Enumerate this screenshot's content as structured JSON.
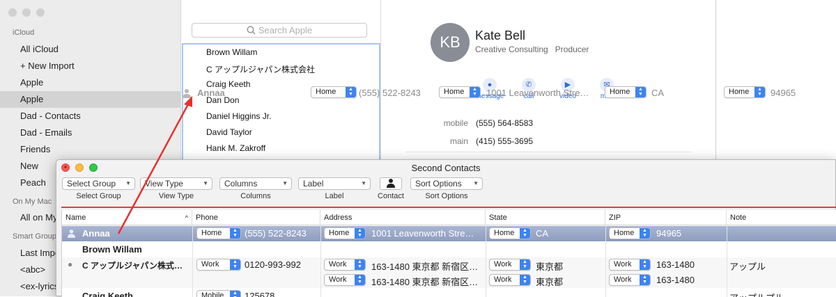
{
  "sidebar": {
    "icloud_header": "iCloud",
    "items": [
      "All iCloud",
      "+ New Import",
      "Apple",
      "Apple",
      "Dad - Contacts",
      "Dad - Emails",
      "Friends",
      "New",
      "Peach"
    ],
    "onmymac_header": "On My Mac",
    "onmymac_items": [
      "All on My Mac"
    ],
    "smart_header": "Smart Groups",
    "smart_items": [
      "Last Import",
      "<abc>",
      "<ex-lyrics>"
    ]
  },
  "search": {
    "placeholder": "Search Apple"
  },
  "contact_list": [
    "Brown Willam",
    "C アップルジャパン株式会社",
    "Craig Keeth",
    "Dan Don",
    "Daniel Higgins Jr.",
    "David Taylor",
    "Hank M. Zakroff"
  ],
  "drag_ghost": {
    "name": "Annaa",
    "phone_label": "Home",
    "phone": "(555) 522-8243",
    "address_label": "Home",
    "address": "1001  Leavenworth Stre…",
    "state_label": "Home",
    "state": "CA",
    "zip_label": "Home",
    "zip": "94965"
  },
  "detail": {
    "initials": "KB",
    "name": "Kate Bell",
    "company": "Creative Consulting",
    "job": "Producer",
    "actions": [
      "message",
      "call",
      "video",
      "mail"
    ],
    "fields": [
      {
        "label": "mobile",
        "value": "(555) 564-8583"
      },
      {
        "label": "main",
        "value": "(415) 555-3695"
      }
    ]
  },
  "front_window": {
    "title": "Second Contacts",
    "toolbar": [
      {
        "popup": "Select Group",
        "label": "Select Group"
      },
      {
        "popup": "View Type",
        "label": "View Type"
      },
      {
        "popup": "Columns",
        "label": "Columns"
      },
      {
        "popup": "Label",
        "label": "Label"
      },
      {
        "popup": "",
        "label": "Contact"
      },
      {
        "popup": "Sort Options",
        "label": "Sort Options"
      }
    ],
    "columns": [
      "Name",
      "Phone",
      "Address",
      "State",
      "ZIP",
      "Note"
    ],
    "rows": [
      {
        "name": "Annaa",
        "phone_label": "Home",
        "phone": "(555) 522-8243",
        "address_label": "Home",
        "address": "1001  Leavenworth Stre…",
        "state_label": "Home",
        "state": "CA",
        "zip_label": "Home",
        "zip": "94965",
        "note": ""
      },
      {
        "name": "Brown Willam"
      },
      {
        "name": "C アップルジャパン株式…",
        "phone_label": "Work",
        "phone": "0120-993-992",
        "address_label": "Work",
        "address": "163-1480 東京都 新宿区…",
        "state_label": "Work",
        "state": "東京都",
        "zip_label": "Work",
        "zip": "163-1480",
        "note": "アップル"
      },
      {
        "name": "",
        "address_label": "Work",
        "address": "163-1480 東京都 新宿区…",
        "state_label": "Work",
        "state": "東京都",
        "zip_label": "Work",
        "zip": "163-1480"
      },
      {
        "name": "Craig Keeth",
        "phone_label": "Mobile",
        "phone": "125678",
        "note": "アップルプル"
      }
    ]
  },
  "colors": {
    "accent": "#3d84f2",
    "drag_arrow": "#e8302a",
    "selection": "#9aa8c8"
  }
}
